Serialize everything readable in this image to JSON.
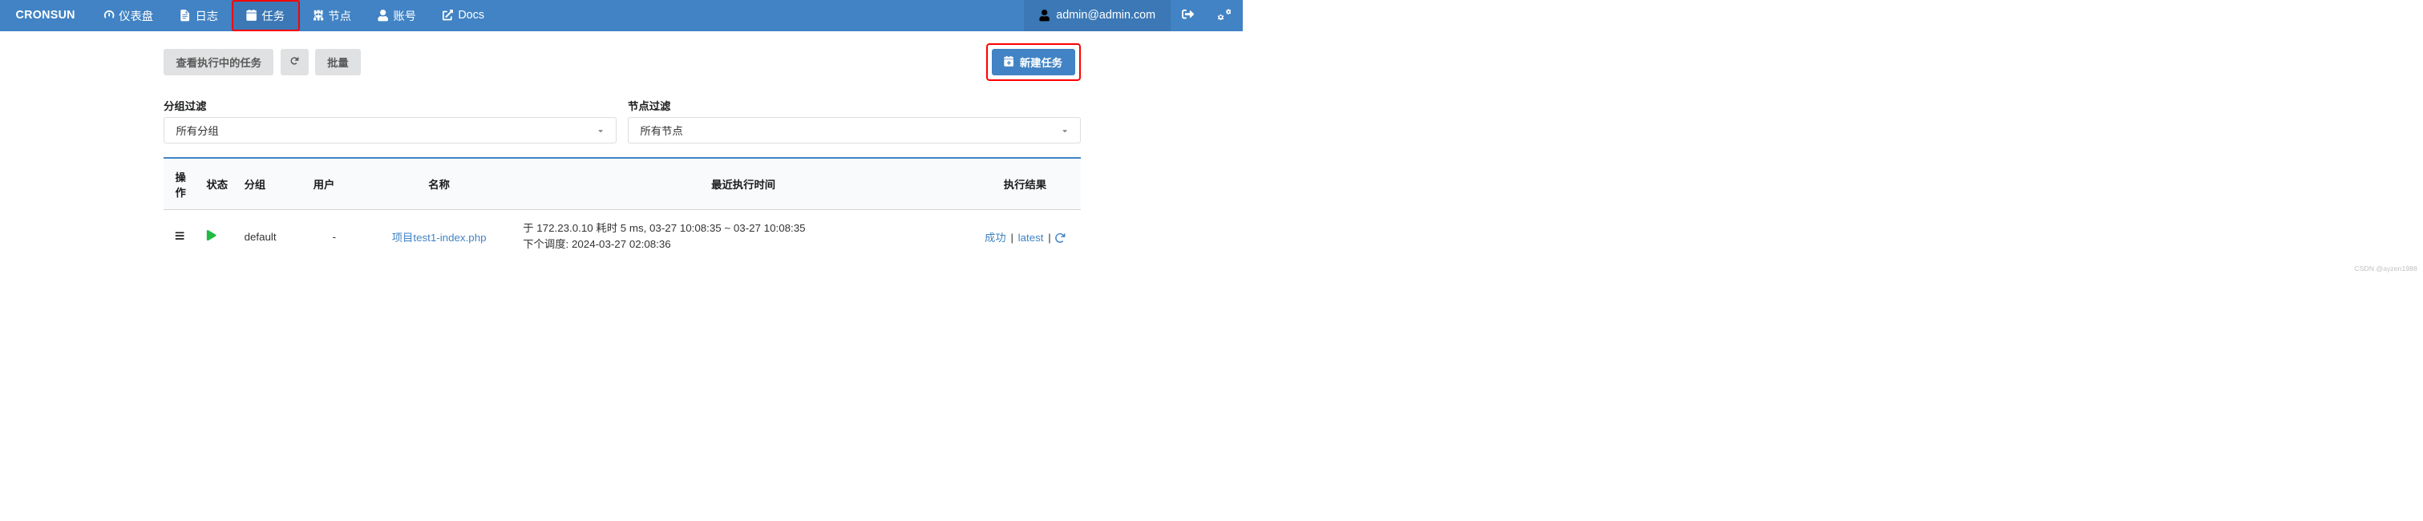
{
  "brand": "CRONSUN",
  "nav": {
    "dashboard": "仪表盘",
    "logs": "日志",
    "tasks": "任务",
    "nodes": "节点",
    "account": "账号",
    "docs": "Docs"
  },
  "user": {
    "email": "admin@admin.com"
  },
  "toolbar": {
    "running_tasks": "查看执行中的任务",
    "batch": "批量",
    "create_task": "新建任务"
  },
  "filters": {
    "group_label": "分组过滤",
    "group_value": "所有分组",
    "node_label": "节点过滤",
    "node_value": "所有节点"
  },
  "table": {
    "headers": {
      "op": "操作",
      "status": "状态",
      "group": "分组",
      "user": "用户",
      "name": "名称",
      "time": "最近执行时间",
      "result": "执行结果"
    },
    "rows": [
      {
        "group": "default",
        "user": "-",
        "name": "项目test1-index.php",
        "time_line1": "于 172.23.0.10 耗时 5 ms, 03-27 10:08:35 ~ 03-27 10:08:35",
        "time_line2": "下个调度: 2024-03-27 02:08:36",
        "result_status": "成功",
        "result_latest": "latest"
      }
    ]
  },
  "watermark": "CSDN @ayzen1988"
}
